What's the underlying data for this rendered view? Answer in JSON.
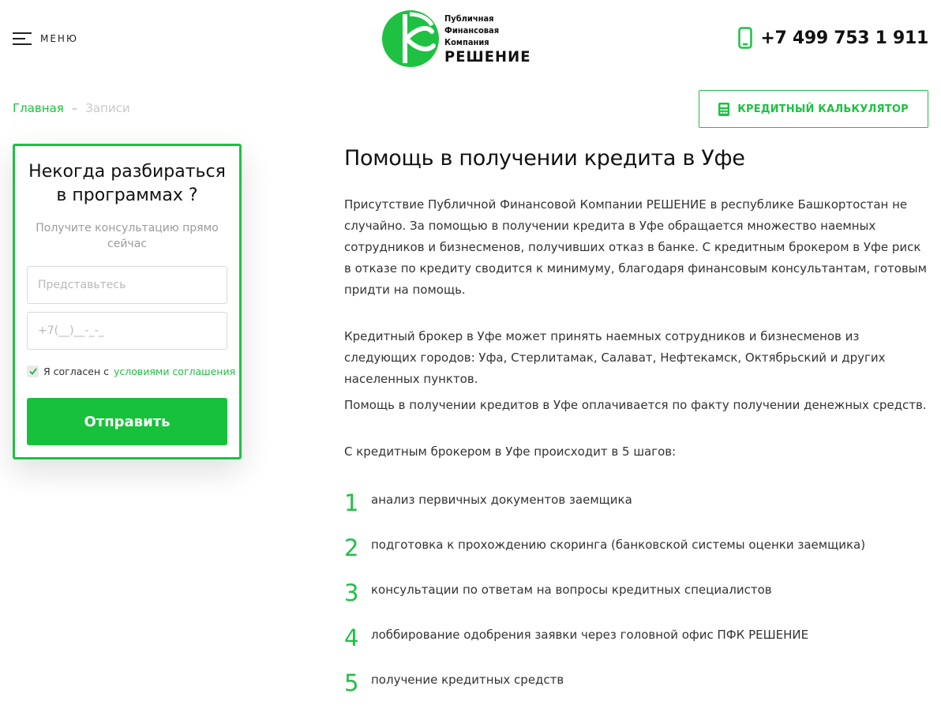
{
  "header": {
    "menu_label": "МЕНЮ",
    "logo_lines": [
      "Публичная",
      "Финансовая",
      "Компания"
    ],
    "logo_name": "РЕШЕНИЕ",
    "phone": "+7 499 753 1 911",
    "phone_icon": "mobile-phone-icon"
  },
  "breadcrumb": {
    "home": "Главная",
    "separator": "–",
    "current": "Записи"
  },
  "calc_button": {
    "label": "КРЕДИТНЫЙ КАЛЬКУЛЯТОР",
    "icon": "calculator-icon"
  },
  "form": {
    "title": "Некогда разбираться в программах ?",
    "subtitle": "Получите консультацию прямо сейчас",
    "name_placeholder": "Представьтесь",
    "phone_placeholder": "+7(__)__-_-_",
    "agree_prefix": "Я согласен с",
    "agree_link": "условиями соглашения",
    "agree_checked": true,
    "submit_label": "Отправить"
  },
  "content": {
    "title": "Помощь в получении кредита в Уфе",
    "paragraphs": [
      "Присутствие Публичной Финансовой Компании РЕШЕНИЕ в республике Башкортостан не случайно. За помощью в получении кредита в Уфе обращается множество наемных сотрудников и бизнесменов, получивших отказ в банке. С кредитным брокером в Уфе риск в отказе по кредиту сводится к минимуму, благодаря финансовым консультантам, готовым придти на помощь.",
      "Кредитный брокер в Уфе может принять наемных сотрудников и бизнесменов из следующих городов: Уфа, Стерлитамак, Салават, Нефтекамск, Октябрьский и других населенных пунктов.",
      "Помощь в получении кредитов в Уфе оплачивается по факту получении денежных средств.",
      "С кредитным брокером в Уфе происходит в 5 шагов:"
    ],
    "steps": [
      {
        "num": "1",
        "text": "анализ первичных документов заемщика"
      },
      {
        "num": "2",
        "text": "подготовка к прохождению скоринга (банковской системы оценки заемщика)"
      },
      {
        "num": "3",
        "text": "консультации по ответам на вопросы кредитных специалистов"
      },
      {
        "num": "4",
        "text": "лоббирование одобрения заявки через головной офис ПФК РЕШЕНИЕ"
      },
      {
        "num": "5",
        "text": "получение кредитных средств"
      }
    ]
  },
  "colors": {
    "accent": "#1ec142",
    "button": "#17c13b",
    "text": "#222222",
    "muted": "#9c9c9c"
  }
}
